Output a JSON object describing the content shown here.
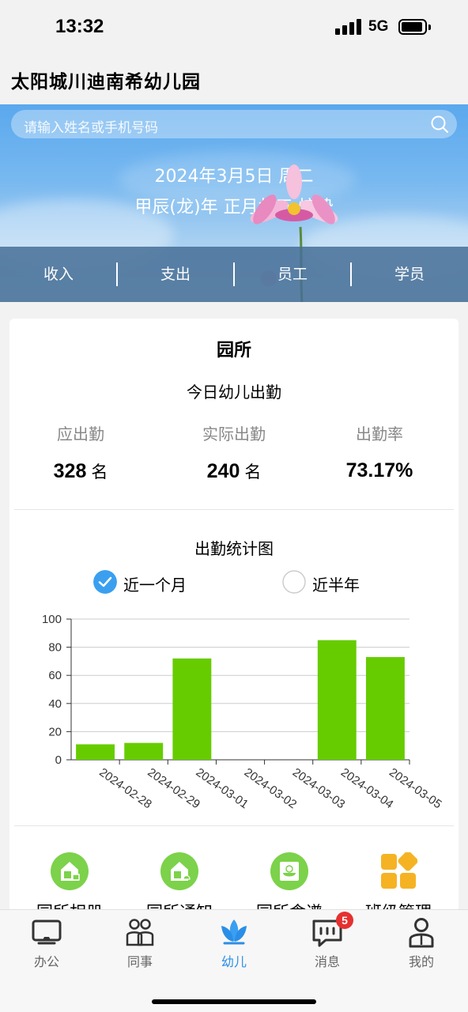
{
  "status": {
    "time": "13:32",
    "network": "5G"
  },
  "header": {
    "title": "太阳城川迪南希幼儿园"
  },
  "banner": {
    "search_placeholder": "请输入姓名或手机号码",
    "date": "2024年3月5日 周二",
    "lunar": "甲辰(龙)年 正月廿五 惊蛰"
  },
  "nav": [
    "收入",
    "支出",
    "员工",
    "学员"
  ],
  "card": {
    "title": "园所",
    "attendance_title": "今日幼儿出勤",
    "stats": [
      {
        "label": "应出勤",
        "value": "328",
        "unit": "名"
      },
      {
        "label": "实际出勤",
        "value": "240",
        "unit": "名"
      },
      {
        "label": "出勤率",
        "value": "73.17%",
        "unit": ""
      }
    ],
    "chart_title": "出勤统计图",
    "range_options": [
      {
        "label": "近一个月",
        "selected": true
      },
      {
        "label": "近半年",
        "selected": false
      }
    ],
    "shortcuts": [
      "园所相册",
      "园所通知",
      "园所食谱",
      "班级管理"
    ]
  },
  "chart_data": {
    "type": "bar",
    "categories": [
      "2024-02-28",
      "2024-02-29",
      "2024-03-01",
      "2024-03-02",
      "2024-03-03",
      "2024-03-04",
      "2024-03-05"
    ],
    "values": [
      11,
      12,
      72,
      0,
      0,
      85,
      73
    ],
    "ylim": [
      0,
      100
    ],
    "yticks": [
      0,
      20,
      40,
      60,
      80,
      100
    ],
    "grid": true,
    "bar_color": "#66cc00",
    "xlabel": "",
    "ylabel": ""
  },
  "tabs": [
    {
      "label": "办公",
      "icon": "desktop-icon",
      "active": false
    },
    {
      "label": "同事",
      "icon": "colleagues-icon",
      "active": false
    },
    {
      "label": "幼儿",
      "icon": "lotus-icon",
      "active": true
    },
    {
      "label": "消息",
      "icon": "message-icon",
      "active": false,
      "badge": "5"
    },
    {
      "label": "我的",
      "icon": "profile-icon",
      "active": false
    }
  ],
  "colors": {
    "accent": "#2b8ee6",
    "bar": "#66cc00",
    "shortcut_green": "#7cd24a",
    "shortcut_orange": "#f5b324",
    "badge": "#e63030"
  }
}
